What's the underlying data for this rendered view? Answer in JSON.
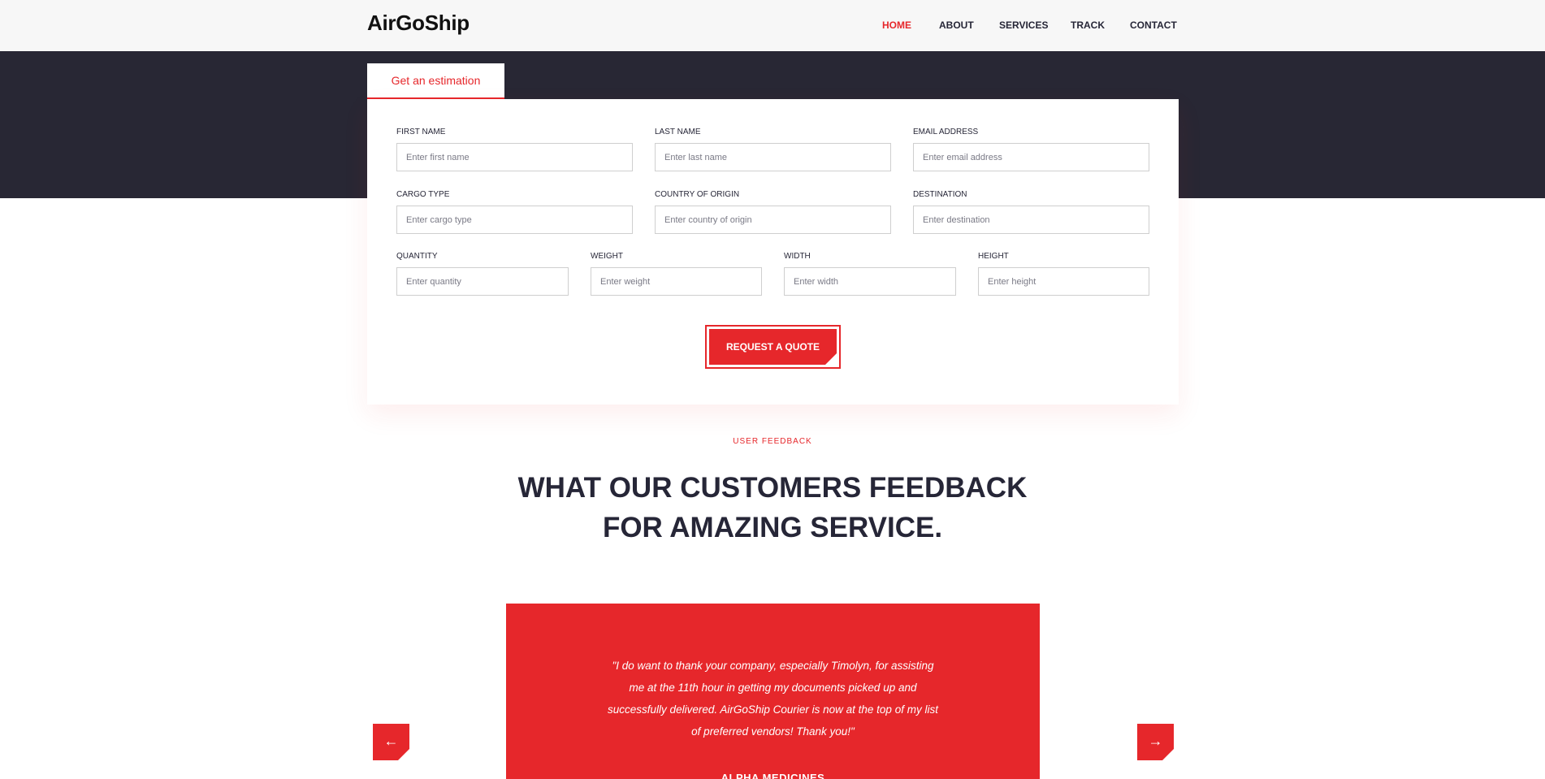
{
  "header": {
    "logo": "AirGoShip",
    "nav": [
      {
        "label": "HOME",
        "active": true
      },
      {
        "label": "ABOUT",
        "active": false
      },
      {
        "label": "SERVICES",
        "active": false
      },
      {
        "label": "TRACK",
        "active": false
      },
      {
        "label": "CONTACT",
        "active": false
      }
    ]
  },
  "form": {
    "tab_label": "Get an estimation",
    "fields": {
      "first_name": {
        "label": "FIRST NAME",
        "placeholder": "Enter first name",
        "value": ""
      },
      "last_name": {
        "label": "LAST NAME",
        "placeholder": "Enter last name",
        "value": ""
      },
      "email": {
        "label": "EMAIL ADDRESS",
        "placeholder": "Enter email address",
        "value": ""
      },
      "cargo_type": {
        "label": "CARGO TYPE",
        "placeholder": "Enter cargo type",
        "value": ""
      },
      "country_of_origin": {
        "label": "COUNTRY OF ORIGIN",
        "placeholder": "Enter country of origin",
        "value": ""
      },
      "destination": {
        "label": "DESTINATION",
        "placeholder": "Enter destination",
        "value": ""
      },
      "quantity": {
        "label": "QUANTITY",
        "placeholder": "Enter quantity",
        "value": ""
      },
      "weight": {
        "label": "WEIGHT",
        "placeholder": "Enter weight",
        "value": ""
      },
      "width": {
        "label": "WIDTH",
        "placeholder": "Enter width",
        "value": ""
      },
      "height": {
        "label": "HEIGHT",
        "placeholder": "Enter height",
        "value": ""
      }
    },
    "submit_label": "REQUEST A QUOTE"
  },
  "feedback": {
    "eyebrow": "USER FEEDBACK",
    "heading_line1": "WHAT OUR CUSTOMERS FEEDBACK",
    "heading_line2": "FOR AMAZING SERVICE.",
    "testimonial": {
      "quote": "\"I do want to thank your company, especially Timolyn, for assisting me at the 11th hour in getting my documents picked up and successfully delivered. AirGoShip Courier is now at the top of my list of preferred vendors! Thank you!\"",
      "author": "ALPHA MEDICINES"
    },
    "prev_icon": "arrow-left-icon",
    "next_icon": "arrow-right-icon"
  },
  "colors": {
    "accent": "#e6272b",
    "dark": "#282734",
    "header_bg": "#f7f7f7",
    "text": "#262637"
  }
}
